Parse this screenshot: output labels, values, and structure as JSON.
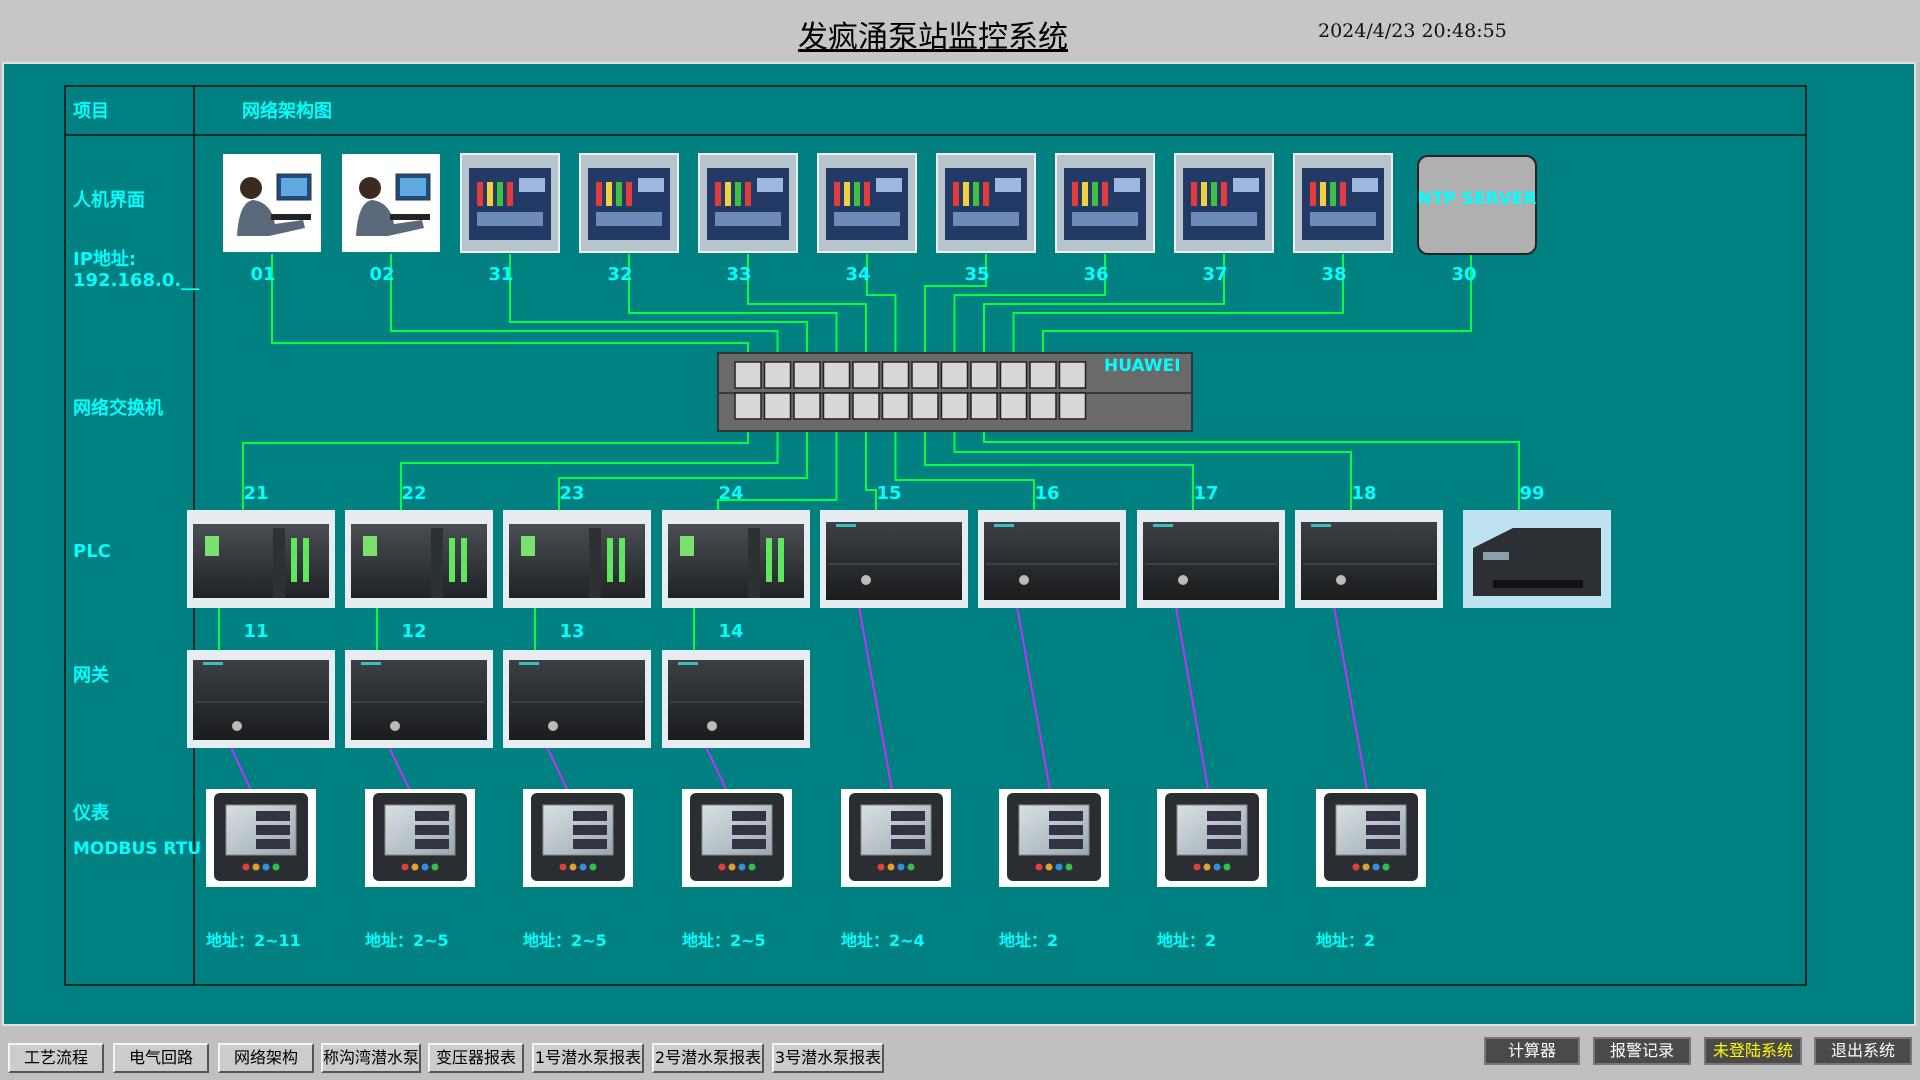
{
  "header": {
    "title": "发疯涌泵站监控系统",
    "datetime": "2024/4/23 20:48:55"
  },
  "table": {
    "col_item": "项目",
    "col_diagram": "网络架构图",
    "rows": {
      "hmi": "人机界面",
      "ip_label": "IP地址:",
      "ip_prefix": "192.168.0.__",
      "switch": "网络交换机",
      "plc": "PLC",
      "gateway": "网关",
      "meter": "仪表",
      "meter_protocol": "MODBUS RTU"
    }
  },
  "hmi_nodes": [
    "01",
    "02",
    "31",
    "32",
    "33",
    "34",
    "35",
    "36",
    "37",
    "38",
    "30"
  ],
  "ntp_label": "NTP SERVER",
  "switch_brand": "HUAWEI",
  "plc_nodes": [
    "21",
    "22",
    "23",
    "24",
    "15",
    "16",
    "17",
    "18",
    "99"
  ],
  "gateway_nodes": [
    "11",
    "12",
    "13",
    "14"
  ],
  "meter_addresses": [
    "地址：2~11",
    "地址：2~5",
    "地址：2~5",
    "地址：2~5",
    "地址：2~4",
    "地址：2",
    "地址：2",
    "地址：2"
  ],
  "nav": [
    "工艺流程",
    "电气回路",
    "网络架构",
    "称沟湾潜水泵",
    "变压器报表",
    "1号潜水泵报表",
    "2号潜水泵报表",
    "3号潜水泵报表"
  ],
  "actions": {
    "calculator": "计算器",
    "alarm": "报警记录",
    "login": "未登陆系统",
    "exit": "退出系统"
  },
  "colors": {
    "panel": "#008080",
    "link_lan": "#00ff40",
    "link_rs485": "#c030ff",
    "label": "#00ffff",
    "login_text": "#ffff00"
  }
}
